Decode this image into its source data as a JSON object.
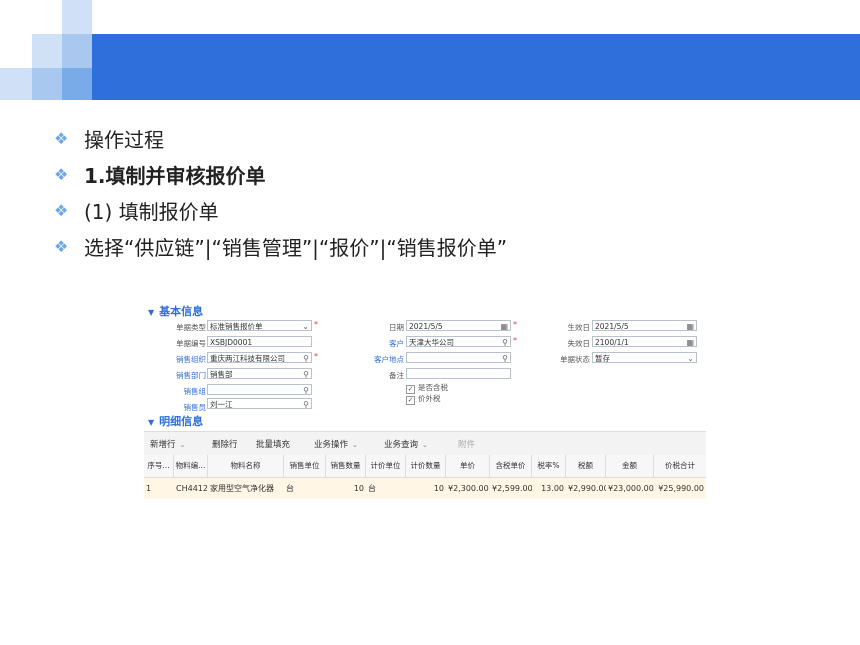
{
  "bullets": [
    {
      "text": "操作过程"
    },
    {
      "text": "1.填制并审核报价单"
    },
    {
      "text": "(1) 填制报价单"
    },
    {
      "text": "选择“供应链”|“销售管理”|“报价”|“销售报价单”"
    }
  ],
  "screenshot": {
    "basic_section_title": "基本信息",
    "detail_section_title": "明细信息",
    "fields": {
      "doc_type": {
        "label": "单据类型",
        "value": "标准销售报价单"
      },
      "doc_no": {
        "label": "单据编号",
        "value": "XSBJD0001"
      },
      "sales_org": {
        "label": "销售组织",
        "value": "重庆两江科技有限公司"
      },
      "sales_dept": {
        "label": "销售部门",
        "value": "销售部"
      },
      "sales_group": {
        "label": "销售组",
        "value": ""
      },
      "salesperson": {
        "label": "销售员",
        "value": "刘一江"
      },
      "date": {
        "label": "日期",
        "value": "2021/5/5"
      },
      "customer": {
        "label": "客户",
        "value": "天津大华公司"
      },
      "customer_site": {
        "label": "客户地点",
        "value": ""
      },
      "remark": {
        "label": "备注",
        "value": ""
      },
      "tax_included": {
        "label": "是否含税",
        "checked": true
      },
      "tax_excluded_price": {
        "label": "价外税",
        "checked": true
      },
      "effective_date": {
        "label": "生效日",
        "value": "2021/5/5"
      },
      "expiry_date": {
        "label": "失效日",
        "value": "2100/1/1"
      },
      "doc_status": {
        "label": "单据状态",
        "value": "暂存"
      }
    },
    "toolbar": {
      "add_row": "新增行",
      "delete_row": "删除行",
      "batch_fill": "批量填充",
      "business_ops": "业务操作",
      "business_query": "业务查询",
      "attachment": "附件"
    },
    "table": {
      "columns": [
        "序号...",
        "物料编...",
        "物料名称",
        "销售单位",
        "销售数量",
        "计价单位",
        "计价数量",
        "单价",
        "含税单价",
        "税率%",
        "税额",
        "金额",
        "价税合计"
      ],
      "rows": [
        [
          "1",
          "CH4412",
          "家用型空气净化器",
          "台",
          "10",
          "台",
          "10",
          "¥2,300.00",
          "¥2,599.00",
          "13.00",
          "¥2,990.00",
          "¥23,000.00",
          "¥25,990.00"
        ]
      ]
    },
    "colors": {
      "accent": "#2f6fdc",
      "row_highlight": "#fff6e6",
      "required": "#e23b3b"
    }
  }
}
